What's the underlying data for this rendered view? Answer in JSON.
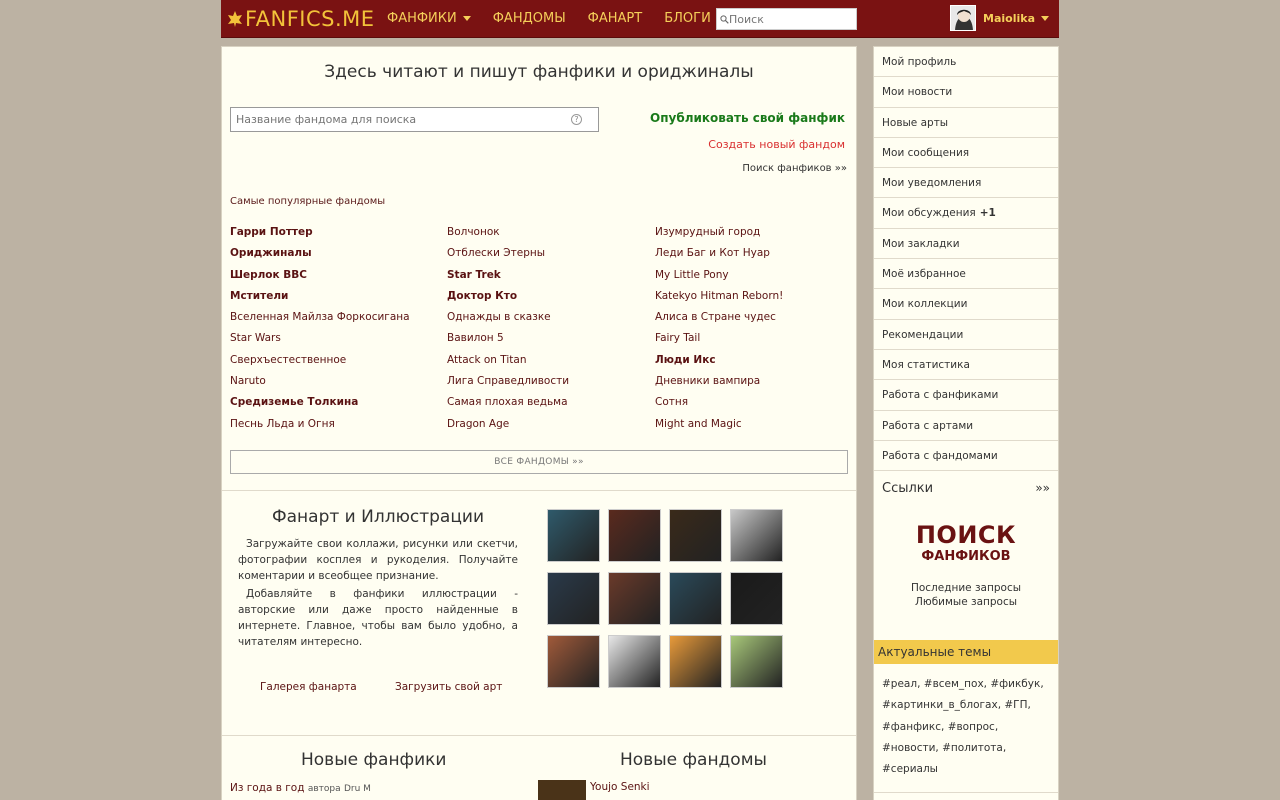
{
  "header": {
    "logo": "FANFICS.ME",
    "nav": [
      {
        "label": "ФАНФИКИ",
        "dropdown": true
      },
      {
        "label": "ФАНДОМЫ",
        "dropdown": false
      },
      {
        "label": "ФАНАРТ",
        "dropdown": false
      },
      {
        "label": "БЛОГИ",
        "dropdown": false
      }
    ],
    "search_placeholder": "Поиск",
    "username": "Maiolika"
  },
  "main": {
    "title": "Здесь читают и пишут фанфики и ориджиналы",
    "fandom_search_placeholder": "Название фандома для поиска",
    "publish_label": "Опубликовать свой фанфик",
    "create_fandom_label": "Создать новый фандом",
    "search_fics_label": "Поиск фанфиков »»",
    "popular_label": "Самые популярные фандомы",
    "fandoms": [
      {
        "label": "Гарри Поттер",
        "bold": true
      },
      {
        "label": "Волчонок",
        "bold": false
      },
      {
        "label": "Изумрудный город",
        "bold": false
      },
      {
        "label": "Ориджиналы",
        "bold": true
      },
      {
        "label": "Отблески Этерны",
        "bold": false
      },
      {
        "label": "Леди Баг и Кот Нуар",
        "bold": false
      },
      {
        "label": "Шерлок BBC",
        "bold": true
      },
      {
        "label": "Star Trek",
        "bold": true
      },
      {
        "label": "My Little Pony",
        "bold": false
      },
      {
        "label": "Мстители",
        "bold": true
      },
      {
        "label": "Доктор Кто",
        "bold": true
      },
      {
        "label": "Katekyo Hitman Reborn!",
        "bold": false
      },
      {
        "label": "Вселенная Майлза Форкосигана",
        "bold": false
      },
      {
        "label": "Однажды в сказке",
        "bold": false
      },
      {
        "label": "Алиса в Стране чудес",
        "bold": false
      },
      {
        "label": "Star Wars",
        "bold": false
      },
      {
        "label": "Вавилон 5",
        "bold": false
      },
      {
        "label": "Fairy Tail",
        "bold": false
      },
      {
        "label": "Сверхъестественное",
        "bold": false
      },
      {
        "label": "Attack on Titan",
        "bold": false
      },
      {
        "label": "Люди Икс",
        "bold": true
      },
      {
        "label": "Naruto",
        "bold": false
      },
      {
        "label": "Лига Справедливости",
        "bold": false
      },
      {
        "label": "Дневники вампира",
        "bold": false
      },
      {
        "label": "Средиземье Толкина",
        "bold": true
      },
      {
        "label": "Самая плохая ведьма",
        "bold": false
      },
      {
        "label": "Сотня",
        "bold": false
      },
      {
        "label": "Песнь Льда и Огня",
        "bold": false
      },
      {
        "label": "Dragon Age",
        "bold": false
      },
      {
        "label": "Might and Magic",
        "bold": false
      }
    ],
    "all_fandoms_label": "ВСЕ ФАНДОМЫ »»",
    "art": {
      "title": "Фанарт и Иллюстрации",
      "desc1": "Загружайте свои коллажи, рисунки или скетчи, фотографии косплея и рукоделия. Получайте коментарии и всеобщее признание.",
      "desc2": "Добавляйте в фанфики иллюстрации - авторские или даже просто найденные в интернете. Главное, чтобы вам было удобно, а читателям интересно.",
      "gallery_label": "Галерея фанарта",
      "upload_label": "Загрузить свой арт",
      "thumb_colors": [
        "#2f5a6b",
        "#5a2a1e",
        "#3a2a1a",
        "#c8c8c8",
        "#2a3a4a",
        "#6a3a2a",
        "#2a4a5a",
        "#1a1a1a",
        "#a05a3a",
        "#e8e8e8",
        "#e89a3a",
        "#a8c87a"
      ]
    },
    "new_fics_title": "Новые фанфики",
    "new_fic": {
      "title": "Из года в год",
      "by": "автора",
      "author": "Dru M"
    },
    "new_fandoms_title": "Новые фандомы",
    "new_fandom": "Youjo Senki"
  },
  "sidebar": {
    "items": [
      {
        "label": "Мой профиль",
        "badge": ""
      },
      {
        "label": "Мои новости",
        "badge": ""
      },
      {
        "label": "Новые арты",
        "badge": ""
      },
      {
        "label": "Мои сообщения",
        "badge": ""
      },
      {
        "label": "Мои уведомления",
        "badge": ""
      },
      {
        "label": "Мои обсуждения",
        "badge": "+1"
      },
      {
        "label": "Мои закладки",
        "badge": ""
      },
      {
        "label": "Моё избранное",
        "badge": ""
      },
      {
        "label": "Мои коллекции",
        "badge": ""
      },
      {
        "label": "Рекомендации",
        "badge": ""
      },
      {
        "label": "Моя статистика",
        "badge": ""
      },
      {
        "label": "Работа с фанфиками",
        "badge": ""
      },
      {
        "label": "Работа с артами",
        "badge": ""
      },
      {
        "label": "Работа с фандомами",
        "badge": ""
      }
    ],
    "links_label": "Ссылки",
    "links_arrow": "»»",
    "poisk_big": "ПОИСК",
    "poisk_small": "ФАНФИКОВ",
    "recent_queries": "Последние запросы",
    "favorite_queries": "Любимые запросы",
    "hot_topics_label": "Актуальные темы",
    "tags": [
      "#реал",
      "#всем_пох",
      "#фикбук",
      "#картинки_в_блогах",
      "#ГП",
      "#фанфикс",
      "#вопрос",
      "#новости",
      "#политота",
      "#сериалы"
    ]
  }
}
